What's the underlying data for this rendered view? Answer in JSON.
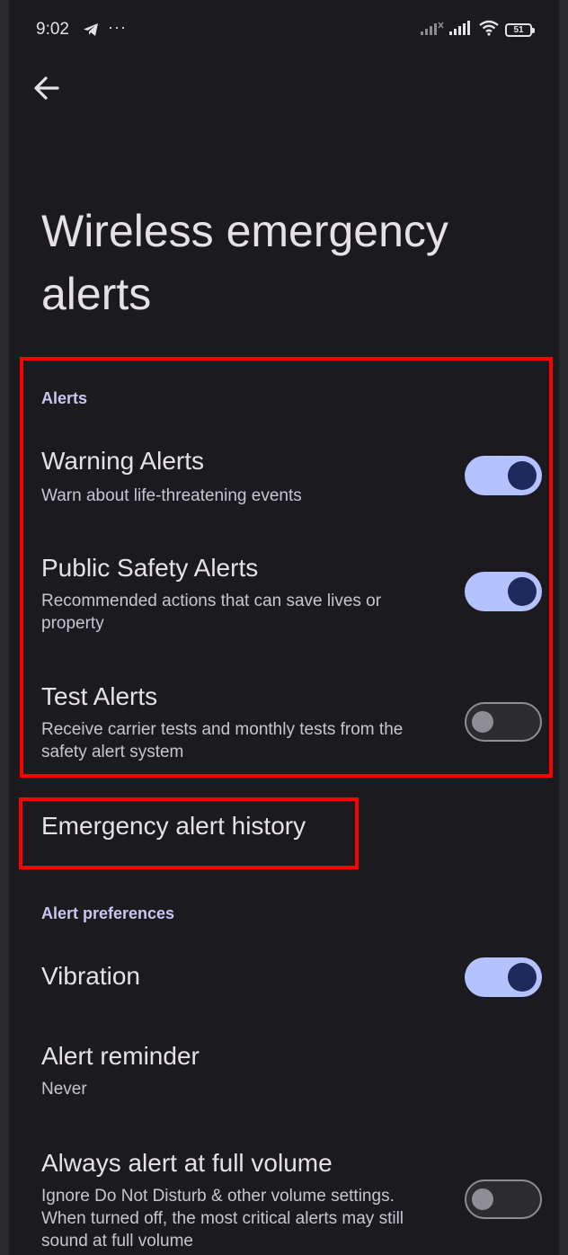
{
  "status_bar": {
    "time": "9:02",
    "more_indicator": "···",
    "battery_level": "51",
    "icons": [
      "telegram-icon",
      "signal-icon",
      "signal-icon",
      "wifi-icon",
      "battery-icon"
    ]
  },
  "header": {
    "back_icon": "arrow-back-icon",
    "title": "Wireless emergency alerts"
  },
  "alerts_section": {
    "header": "Alerts",
    "items": [
      {
        "title": "Warning Alerts",
        "summary": "Warn about life-threatening events",
        "enabled": true
      },
      {
        "title": "Public Safety Alerts",
        "summary": "Recommended actions that can save lives or property",
        "enabled": true
      },
      {
        "title": "Test Alerts",
        "summary": "Receive carrier tests and monthly tests from the safety alert system",
        "enabled": false
      }
    ]
  },
  "history": {
    "title": "Emergency alert history"
  },
  "preferences_section": {
    "header": "Alert preferences",
    "vibration": {
      "title": "Vibration",
      "enabled": true
    },
    "reminder": {
      "title": "Alert reminder",
      "summary": "Never"
    },
    "full_volume": {
      "title": "Always alert at full volume",
      "summary": "Ignore Do Not Disturb & other volume settings. When turned off, the most critical alerts may still sound at full volume",
      "enabled": false
    }
  },
  "colors": {
    "background": "#1b1b1f",
    "accent": "#b4c2ff",
    "highlight": "#ff0000"
  }
}
